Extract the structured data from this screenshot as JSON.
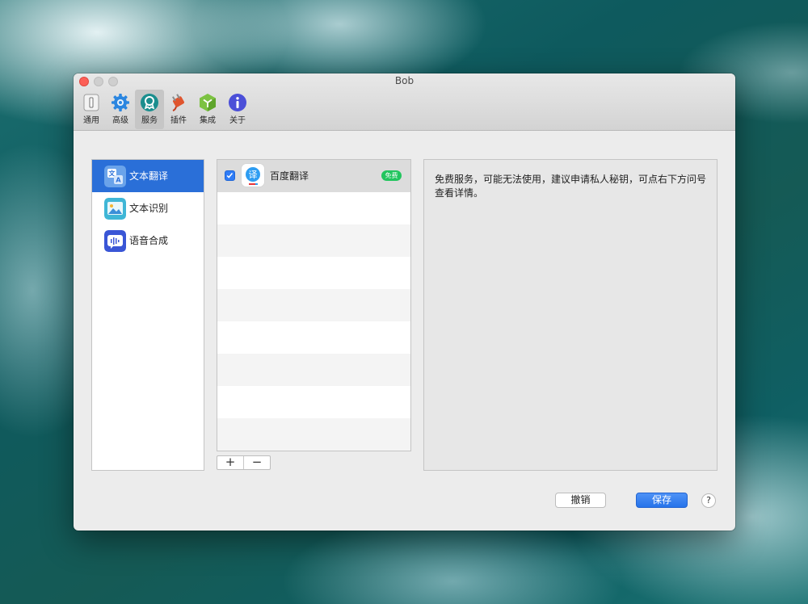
{
  "window": {
    "title": "Bob"
  },
  "toolbar": {
    "items": [
      {
        "label": "通用",
        "icon": "switch-icon"
      },
      {
        "label": "高级",
        "icon": "gear-icon"
      },
      {
        "label": "服务",
        "icon": "badge-icon",
        "active": true
      },
      {
        "label": "插件",
        "icon": "plug-icon"
      },
      {
        "label": "集成",
        "icon": "cube-icon"
      },
      {
        "label": "关于",
        "icon": "info-icon"
      }
    ]
  },
  "sidebar": {
    "items": [
      {
        "label": "文本翻译",
        "icon": "translate-icon",
        "selected": true
      },
      {
        "label": "文本识别",
        "icon": "image-recognition-icon"
      },
      {
        "label": "语音合成",
        "icon": "speech-synthesis-icon"
      }
    ]
  },
  "services": {
    "items": [
      {
        "name": "百度翻译",
        "badge": "免费",
        "enabled": true,
        "icon": "baidu-translate-icon"
      }
    ],
    "add_label": "+",
    "remove_label": "−"
  },
  "detail": {
    "text": "免费服务，可能无法使用，建议申请私人秘钥，可点右下方问号查看详情。"
  },
  "footer": {
    "cancel_label": "撤销",
    "save_label": "保存",
    "help_label": "?"
  },
  "colors": {
    "accent": "#2a6fd8",
    "free_badge": "#22c55e",
    "close_button": "#fc5f57"
  }
}
